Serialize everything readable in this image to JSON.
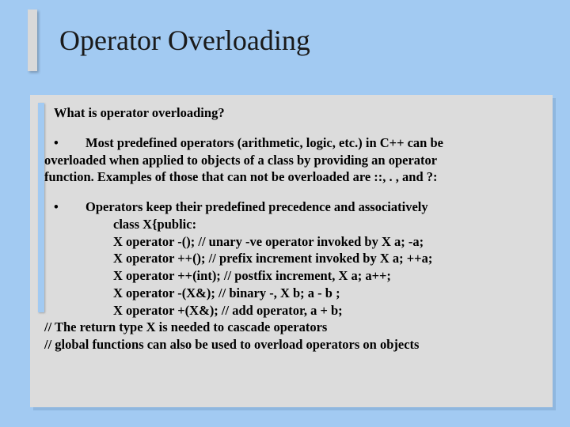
{
  "title": "Operator Overloading",
  "question": "What is operator overloading?",
  "para1_line1": "Most predefined operators (arithmetic, logic, etc.) in C++ can be",
  "para1_line2": "overloaded when applied to objects of  a class by providing an operator",
  "para1_line3": "function. Examples of those that can not  be overloaded are ::, . ,  and ?:",
  "para2_line1": "Operators keep their predefined precedence and associatively",
  "code1": "class X{public:",
  "code2": "X operator -(); // unary -ve operator invoked by X a; -a;",
  "code3": "X operator ++(); // prefix increment invoked by X a; ++a;",
  "code4": "X operator ++(int); // postfix increment, X a; a++;",
  "code5": "X operator -(X&); // binary -, X b; a - b ;",
  "code6": "X operator +(X&); // add operator,  a + b;",
  "comment1": "// The return type X is needed to cascade operators",
  "comment2": "// global functions can also be used to overload operators on objects"
}
